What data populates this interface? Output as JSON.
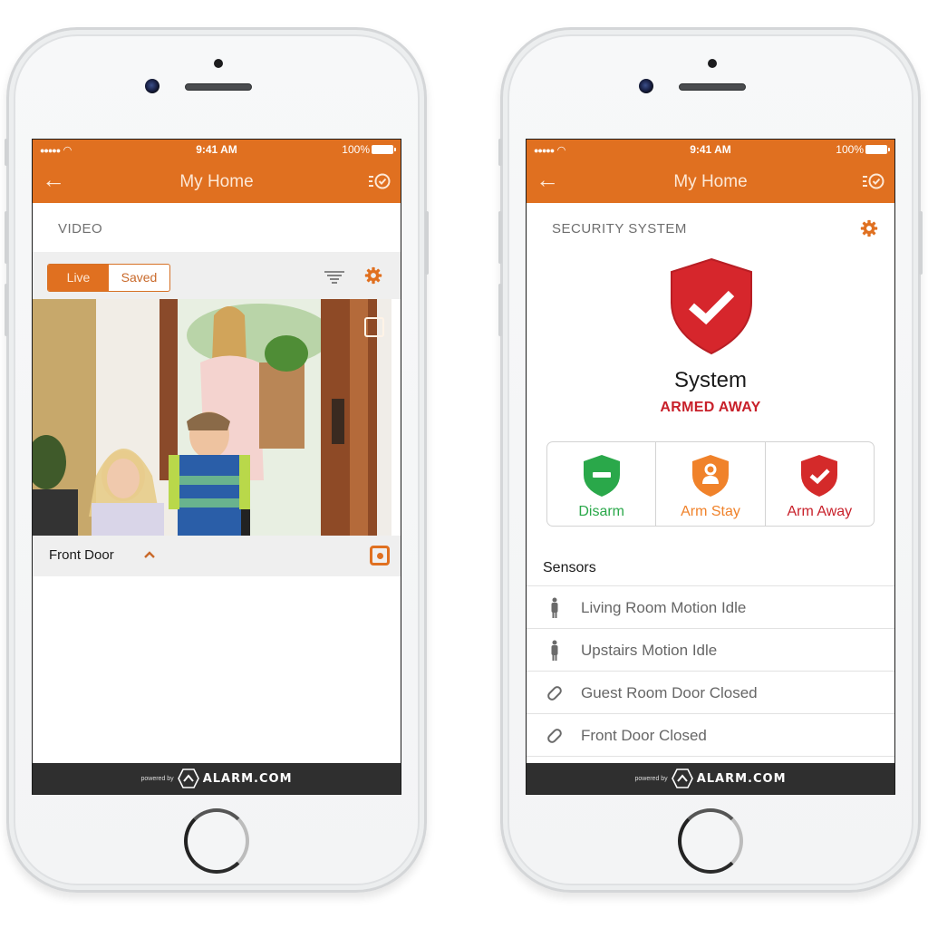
{
  "colors": {
    "brand_orange": "#e07020",
    "armed_red": "#c8202a",
    "disarm_green": "#2aa84a",
    "arm_stay_orange": "#f0822a",
    "arm_away_red": "#d42a2a",
    "footer_dark": "#2f2f2f"
  },
  "phones": [
    {
      "status_bar": {
        "signal": "●●●●●",
        "wifi_icon": "wifi-icon",
        "time": "9:41 AM",
        "battery": "100%"
      },
      "nav": {
        "back_icon": "arrow-left-icon",
        "title": "My Home",
        "tasks_icon": "list-check-icon"
      },
      "section_label": "VIDEO",
      "toolbar": {
        "segments": [
          {
            "label": "Live",
            "active": true
          },
          {
            "label": "Saved",
            "active": false
          }
        ],
        "filter_icon": "filter-icon",
        "settings_icon": "gear-icon"
      },
      "video": {
        "expand_icon": "expand-icon",
        "scene": "Woman with grocery bag and two children entering front door"
      },
      "camera_bar": {
        "name": "Front Door",
        "chevron_icon": "chevron-up-icon",
        "record_icon": "record-icon"
      },
      "footer": {
        "powered_by": "powered by",
        "brand": "ALARM.COM"
      }
    },
    {
      "status_bar": {
        "signal": "●●●●●",
        "wifi_icon": "wifi-icon",
        "time": "9:41 AM",
        "battery": "100%"
      },
      "nav": {
        "back_icon": "arrow-left-icon",
        "title": "My Home",
        "tasks_icon": "list-check-icon"
      },
      "section_label": "SECURITY SYSTEM",
      "system": {
        "name": "System",
        "state": "ARMED AWAY",
        "status_icon": "shield-check-icon"
      },
      "arm_buttons": [
        {
          "label": "Disarm",
          "icon": "shield-minus-icon",
          "color": "#2aa84a"
        },
        {
          "label": "Arm Stay",
          "icon": "shield-person-icon",
          "color": "#f0822a"
        },
        {
          "label": "Arm Away",
          "icon": "shield-check-icon",
          "color": "#d42a2a"
        }
      ],
      "sensors_title": "Sensors",
      "sensors": [
        {
          "label": "Living Room Motion Idle",
          "icon": "motion-person-icon"
        },
        {
          "label": "Upstairs Motion Idle",
          "icon": "motion-person-icon"
        },
        {
          "label": "Guest Room Door Closed",
          "icon": "door-contact-icon"
        },
        {
          "label": "Front Door Closed",
          "icon": "door-contact-icon"
        }
      ],
      "footer": {
        "powered_by": "powered by",
        "brand": "ALARM.COM"
      }
    }
  ]
}
